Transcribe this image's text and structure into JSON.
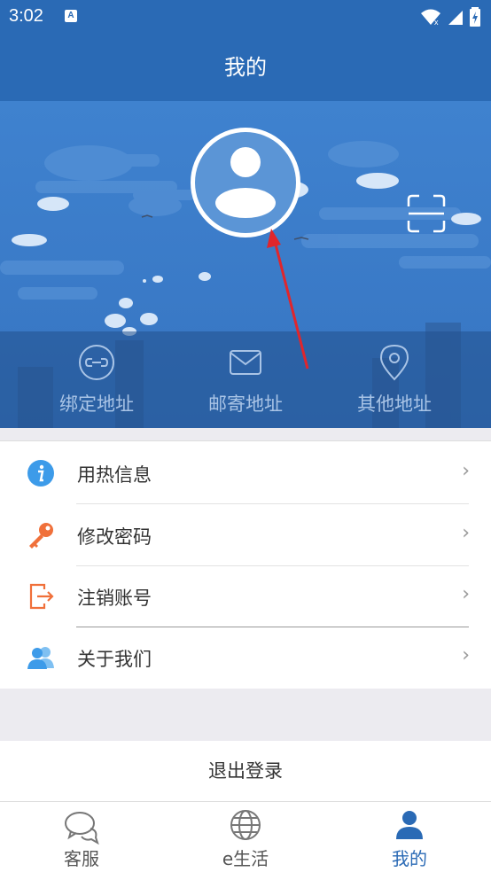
{
  "status": {
    "time": "3:02",
    "a_badge": "A"
  },
  "header": {
    "title": "我的"
  },
  "addresses": [
    {
      "label": "绑定地址",
      "icon": "link-icon"
    },
    {
      "label": "邮寄地址",
      "icon": "mail-icon"
    },
    {
      "label": "其他地址",
      "icon": "location-pin-icon"
    }
  ],
  "menu": [
    {
      "label": "用热信息",
      "icon": "info-icon",
      "chevron": "›"
    },
    {
      "label": "修改密码",
      "icon": "key-icon",
      "chevron": "›"
    },
    {
      "label": "注销账号",
      "icon": "exit-icon",
      "chevron": "›"
    },
    {
      "label": "关于我们",
      "icon": "users-icon",
      "chevron": "›"
    }
  ],
  "logout": {
    "label": "退出登录"
  },
  "tabs": [
    {
      "label": "客服",
      "icon": "chat-icon",
      "active": false
    },
    {
      "label": "e生活",
      "icon": "globe-icon",
      "active": false
    },
    {
      "label": "我的",
      "icon": "person-icon",
      "active": true
    }
  ],
  "colors": {
    "primary": "#2a6ab5",
    "hero": "#3f82cf",
    "arrow": "#e0262c",
    "info": "#3d9be9",
    "key": "#f0703a"
  }
}
